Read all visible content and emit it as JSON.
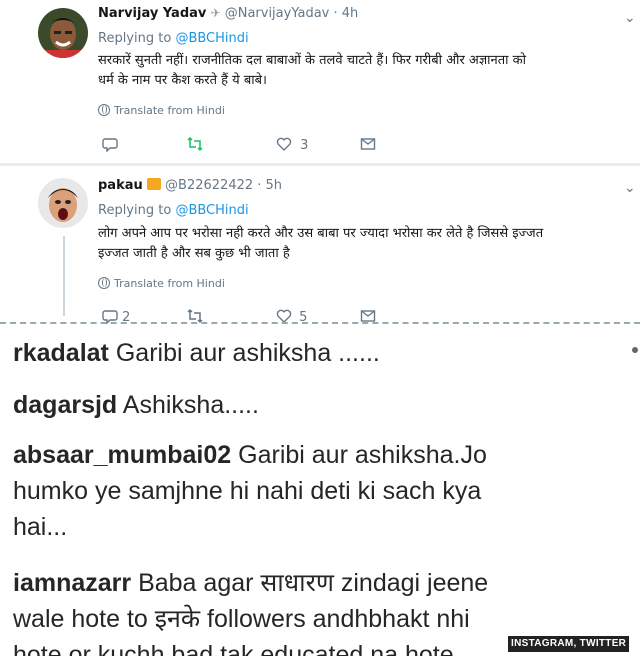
{
  "tweet1": {
    "name": "Narvijay Yadav",
    "handle": "@NarvijayYadav · 4h",
    "replying_prefix": "Replying to",
    "replying_to": "@BBCHindi",
    "text_line1": "सरकारें सुनती नहीं। राजनीतिक दल बाबाओं के तलवे चाटते हैं। फिर गरीबी और अज्ञानता को",
    "text_line2": "धर्म के नाम पर कैश करते हैं ये बाबे।",
    "translate": "Translate from Hindi",
    "likes": "3"
  },
  "tweet2": {
    "name": "pakau",
    "handle": "@B22622422 · 5h",
    "replying_prefix": "Replying to",
    "replying_to": "@BBCHindi",
    "text_line1": "लोग अपने आप पर भरोसा नही करते और उस बाबा पर ज्यादा भरोसा कर लेते है जिससे इज्जत",
    "text_line2": "इज्जत जाती है और सब कुछ भी जाता है",
    "translate": "Translate from Hindi",
    "replies": "2",
    "likes": "5"
  },
  "instagram_comments": [
    {
      "user": "rkadalat",
      "text": "Garibi aur ashiksha ......"
    },
    {
      "user": "dagarsjd",
      "text": "Ashiksha....."
    },
    {
      "user": "absaar_mumbai02",
      "text": "Garibi aur ashiksha.Jo",
      "line2": "humko ye samjhne hi nahi deti ki sach kya",
      "line3": "hai..."
    },
    {
      "user": "iamnazarr",
      "text": "Baba agar साधारण zindagi jeene",
      "line2": "wale hote to इनके followers andhbhakt nhi",
      "line3": "hote or kuchh bad tak educated na hote"
    }
  ],
  "credit": "INSTAGRAM, TWITTER",
  "colors": {
    "link": "#1b95e0",
    "muted": "#657786",
    "text": "#14171a"
  }
}
